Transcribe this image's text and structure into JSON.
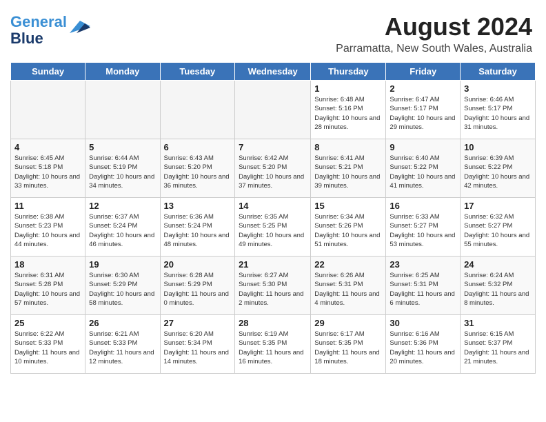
{
  "header": {
    "title": "August 2024",
    "subtitle": "Parramatta, New South Wales, Australia",
    "logo_line1": "General",
    "logo_line2": "Blue"
  },
  "weekdays": [
    "Sunday",
    "Monday",
    "Tuesday",
    "Wednesday",
    "Thursday",
    "Friday",
    "Saturday"
  ],
  "weeks": [
    [
      {
        "day": "",
        "empty": true
      },
      {
        "day": "",
        "empty": true
      },
      {
        "day": "",
        "empty": true
      },
      {
        "day": "",
        "empty": true
      },
      {
        "day": "1",
        "sunrise": "6:48 AM",
        "sunset": "5:16 PM",
        "daylight": "10 hours and 28 minutes."
      },
      {
        "day": "2",
        "sunrise": "6:47 AM",
        "sunset": "5:17 PM",
        "daylight": "10 hours and 29 minutes."
      },
      {
        "day": "3",
        "sunrise": "6:46 AM",
        "sunset": "5:17 PM",
        "daylight": "10 hours and 31 minutes."
      }
    ],
    [
      {
        "day": "4",
        "sunrise": "6:45 AM",
        "sunset": "5:18 PM",
        "daylight": "10 hours and 33 minutes."
      },
      {
        "day": "5",
        "sunrise": "6:44 AM",
        "sunset": "5:19 PM",
        "daylight": "10 hours and 34 minutes."
      },
      {
        "day": "6",
        "sunrise": "6:43 AM",
        "sunset": "5:20 PM",
        "daylight": "10 hours and 36 minutes."
      },
      {
        "day": "7",
        "sunrise": "6:42 AM",
        "sunset": "5:20 PM",
        "daylight": "10 hours and 37 minutes."
      },
      {
        "day": "8",
        "sunrise": "6:41 AM",
        "sunset": "5:21 PM",
        "daylight": "10 hours and 39 minutes."
      },
      {
        "day": "9",
        "sunrise": "6:40 AM",
        "sunset": "5:22 PM",
        "daylight": "10 hours and 41 minutes."
      },
      {
        "day": "10",
        "sunrise": "6:39 AM",
        "sunset": "5:22 PM",
        "daylight": "10 hours and 42 minutes."
      }
    ],
    [
      {
        "day": "11",
        "sunrise": "6:38 AM",
        "sunset": "5:23 PM",
        "daylight": "10 hours and 44 minutes."
      },
      {
        "day": "12",
        "sunrise": "6:37 AM",
        "sunset": "5:24 PM",
        "daylight": "10 hours and 46 minutes."
      },
      {
        "day": "13",
        "sunrise": "6:36 AM",
        "sunset": "5:24 PM",
        "daylight": "10 hours and 48 minutes."
      },
      {
        "day": "14",
        "sunrise": "6:35 AM",
        "sunset": "5:25 PM",
        "daylight": "10 hours and 49 minutes."
      },
      {
        "day": "15",
        "sunrise": "6:34 AM",
        "sunset": "5:26 PM",
        "daylight": "10 hours and 51 minutes."
      },
      {
        "day": "16",
        "sunrise": "6:33 AM",
        "sunset": "5:27 PM",
        "daylight": "10 hours and 53 minutes."
      },
      {
        "day": "17",
        "sunrise": "6:32 AM",
        "sunset": "5:27 PM",
        "daylight": "10 hours and 55 minutes."
      }
    ],
    [
      {
        "day": "18",
        "sunrise": "6:31 AM",
        "sunset": "5:28 PM",
        "daylight": "10 hours and 57 minutes."
      },
      {
        "day": "19",
        "sunrise": "6:30 AM",
        "sunset": "5:29 PM",
        "daylight": "10 hours and 58 minutes."
      },
      {
        "day": "20",
        "sunrise": "6:28 AM",
        "sunset": "5:29 PM",
        "daylight": "11 hours and 0 minutes."
      },
      {
        "day": "21",
        "sunrise": "6:27 AM",
        "sunset": "5:30 PM",
        "daylight": "11 hours and 2 minutes."
      },
      {
        "day": "22",
        "sunrise": "6:26 AM",
        "sunset": "5:31 PM",
        "daylight": "11 hours and 4 minutes."
      },
      {
        "day": "23",
        "sunrise": "6:25 AM",
        "sunset": "5:31 PM",
        "daylight": "11 hours and 6 minutes."
      },
      {
        "day": "24",
        "sunrise": "6:24 AM",
        "sunset": "5:32 PM",
        "daylight": "11 hours and 8 minutes."
      }
    ],
    [
      {
        "day": "25",
        "sunrise": "6:22 AM",
        "sunset": "5:33 PM",
        "daylight": "11 hours and 10 minutes."
      },
      {
        "day": "26",
        "sunrise": "6:21 AM",
        "sunset": "5:33 PM",
        "daylight": "11 hours and 12 minutes."
      },
      {
        "day": "27",
        "sunrise": "6:20 AM",
        "sunset": "5:34 PM",
        "daylight": "11 hours and 14 minutes."
      },
      {
        "day": "28",
        "sunrise": "6:19 AM",
        "sunset": "5:35 PM",
        "daylight": "11 hours and 16 minutes."
      },
      {
        "day": "29",
        "sunrise": "6:17 AM",
        "sunset": "5:35 PM",
        "daylight": "11 hours and 18 minutes."
      },
      {
        "day": "30",
        "sunrise": "6:16 AM",
        "sunset": "5:36 PM",
        "daylight": "11 hours and 20 minutes."
      },
      {
        "day": "31",
        "sunrise": "6:15 AM",
        "sunset": "5:37 PM",
        "daylight": "11 hours and 21 minutes."
      }
    ]
  ],
  "labels": {
    "sunrise": "Sunrise:",
    "sunset": "Sunset:",
    "daylight": "Daylight:"
  }
}
